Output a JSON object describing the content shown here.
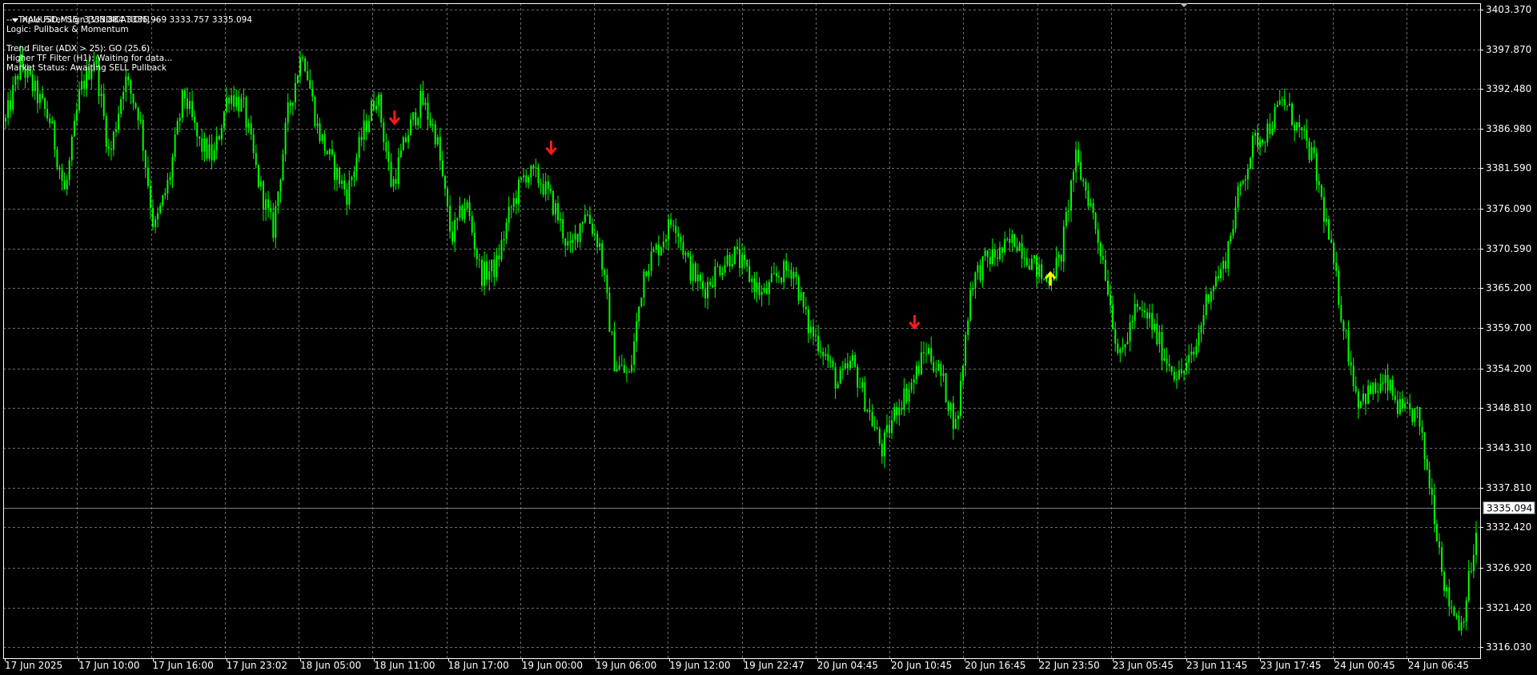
{
  "header": {
    "symbol_line": "XAUUSD,M15  3333.884 3335.969 3333.757 3335.094",
    "indicator_lines": [
      "--- Triple Filter Sign [VINDICATION] ---",
      "Logic: Pullback & Momentum",
      "",
      "Trend Filter (ADX > 25): GO (25.6)",
      "Higher TF Filter (H1): Waiting for data...",
      "Market Status: Awaiting SELL Pullback"
    ]
  },
  "colors": {
    "background": "#000000",
    "candle": "#00ff00",
    "grid": "#6b6b6b",
    "axis_text": "#ffffff",
    "price_line": "#708090",
    "sell_arrow": "#ff1a1a",
    "buy_arrow": "#ffff00"
  },
  "chart_data": {
    "type": "candlestick",
    "symbol": "XAUUSD",
    "timeframe": "M15",
    "current_price": 3335.094,
    "y_ticks": [
      3403.37,
      3397.87,
      3392.48,
      3386.98,
      3381.59,
      3376.09,
      3370.59,
      3365.2,
      3359.7,
      3354.2,
      3348.81,
      3343.31,
      3337.81,
      3332.42,
      3326.92,
      3321.42,
      3316.03
    ],
    "x_ticks": [
      "17 Jun 2025",
      "17 Jun 10:00",
      "17 Jun 16:00",
      "17 Jun 23:02",
      "18 Jun 05:00",
      "18 Jun 11:00",
      "18 Jun 17:00",
      "19 Jun 00:00",
      "19 Jun 06:00",
      "19 Jun 12:00",
      "19 Jun 22:47",
      "20 Jun 04:45",
      "20 Jun 10:45",
      "20 Jun 16:45",
      "22 Jun 23:50",
      "23 Jun 05:45",
      "23 Jun 11:45",
      "23 Jun 17:45",
      "24 Jun 00:45",
      "24 Jun 06:45"
    ],
    "ylim": [
      3314.5,
      3404.2
    ],
    "price_path": [
      [
        0,
        3388
      ],
      [
        1,
        3396
      ],
      [
        2,
        3392
      ],
      [
        3,
        3388
      ],
      [
        4,
        3378
      ],
      [
        5,
        3392
      ],
      [
        6,
        3397
      ],
      [
        7,
        3383
      ],
      [
        8,
        3394
      ],
      [
        9,
        3389
      ],
      [
        10,
        3373
      ],
      [
        11,
        3380
      ],
      [
        12,
        3392
      ],
      [
        13,
        3385
      ],
      [
        14,
        3383
      ],
      [
        15,
        3392
      ],
      [
        16,
        3390
      ],
      [
        17,
        3380
      ],
      [
        18,
        3373
      ],
      [
        19,
        3389
      ],
      [
        20,
        3398
      ],
      [
        21,
        3387
      ],
      [
        22,
        3382
      ],
      [
        23,
        3378
      ],
      [
        24,
        3386
      ],
      [
        25,
        3392
      ],
      [
        26,
        3379
      ],
      [
        27,
        3386
      ],
      [
        28,
        3391
      ],
      [
        29,
        3386
      ],
      [
        30,
        3372
      ],
      [
        31,
        3377
      ],
      [
        32,
        3367
      ],
      [
        33,
        3368
      ],
      [
        34,
        3376
      ],
      [
        35,
        3381
      ],
      [
        36,
        3380
      ],
      [
        37,
        3376
      ],
      [
        38,
        3370
      ],
      [
        39,
        3376
      ],
      [
        40,
        3371
      ],
      [
        41,
        3355
      ],
      [
        42,
        3353
      ],
      [
        43,
        3368
      ],
      [
        44,
        3371
      ],
      [
        45,
        3375
      ],
      [
        46,
        3368
      ],
      [
        47,
        3365
      ],
      [
        48,
        3368
      ],
      [
        49,
        3370
      ],
      [
        50,
        3367
      ],
      [
        51,
        3364
      ],
      [
        52,
        3367
      ],
      [
        53,
        3368
      ],
      [
        54,
        3360
      ],
      [
        55,
        3357
      ],
      [
        56,
        3352
      ],
      [
        57,
        3355
      ],
      [
        58,
        3349
      ],
      [
        59,
        3343
      ],
      [
        60,
        3349
      ],
      [
        61,
        3352
      ],
      [
        62,
        3357
      ],
      [
        63,
        3353
      ],
      [
        64,
        3346
      ],
      [
        65,
        3366
      ],
      [
        66,
        3369
      ],
      [
        67,
        3370
      ],
      [
        68,
        3372
      ],
      [
        69,
        3369
      ],
      [
        70,
        3366
      ],
      [
        71,
        3369
      ],
      [
        72,
        3383
      ],
      [
        73,
        3377
      ],
      [
        74,
        3368
      ],
      [
        75,
        3355
      ],
      [
        76,
        3362
      ],
      [
        77,
        3361
      ],
      [
        78,
        3356
      ],
      [
        79,
        3353
      ],
      [
        80,
        3356
      ],
      [
        81,
        3365
      ],
      [
        82,
        3368
      ],
      [
        83,
        3378
      ],
      [
        84,
        3385
      ],
      [
        85,
        3387
      ],
      [
        86,
        3391
      ],
      [
        87,
        3387
      ],
      [
        88,
        3383
      ],
      [
        89,
        3373
      ],
      [
        90,
        3361
      ],
      [
        91,
        3350
      ],
      [
        92,
        3351
      ],
      [
        93,
        3352
      ],
      [
        94,
        3348
      ],
      [
        95,
        3348
      ],
      [
        96,
        3337
      ],
      [
        97,
        3323
      ],
      [
        98,
        3319
      ],
      [
        99,
        3331
      ]
    ],
    "signals": [
      {
        "type": "sell",
        "price": 3388.5,
        "position": 0.265
      },
      {
        "type": "sell",
        "price": 3384.4,
        "position": 0.371
      },
      {
        "type": "sell",
        "price": 3360.5,
        "position": 0.617
      },
      {
        "type": "buy",
        "price": 3366.5,
        "position": 0.709
      }
    ]
  }
}
